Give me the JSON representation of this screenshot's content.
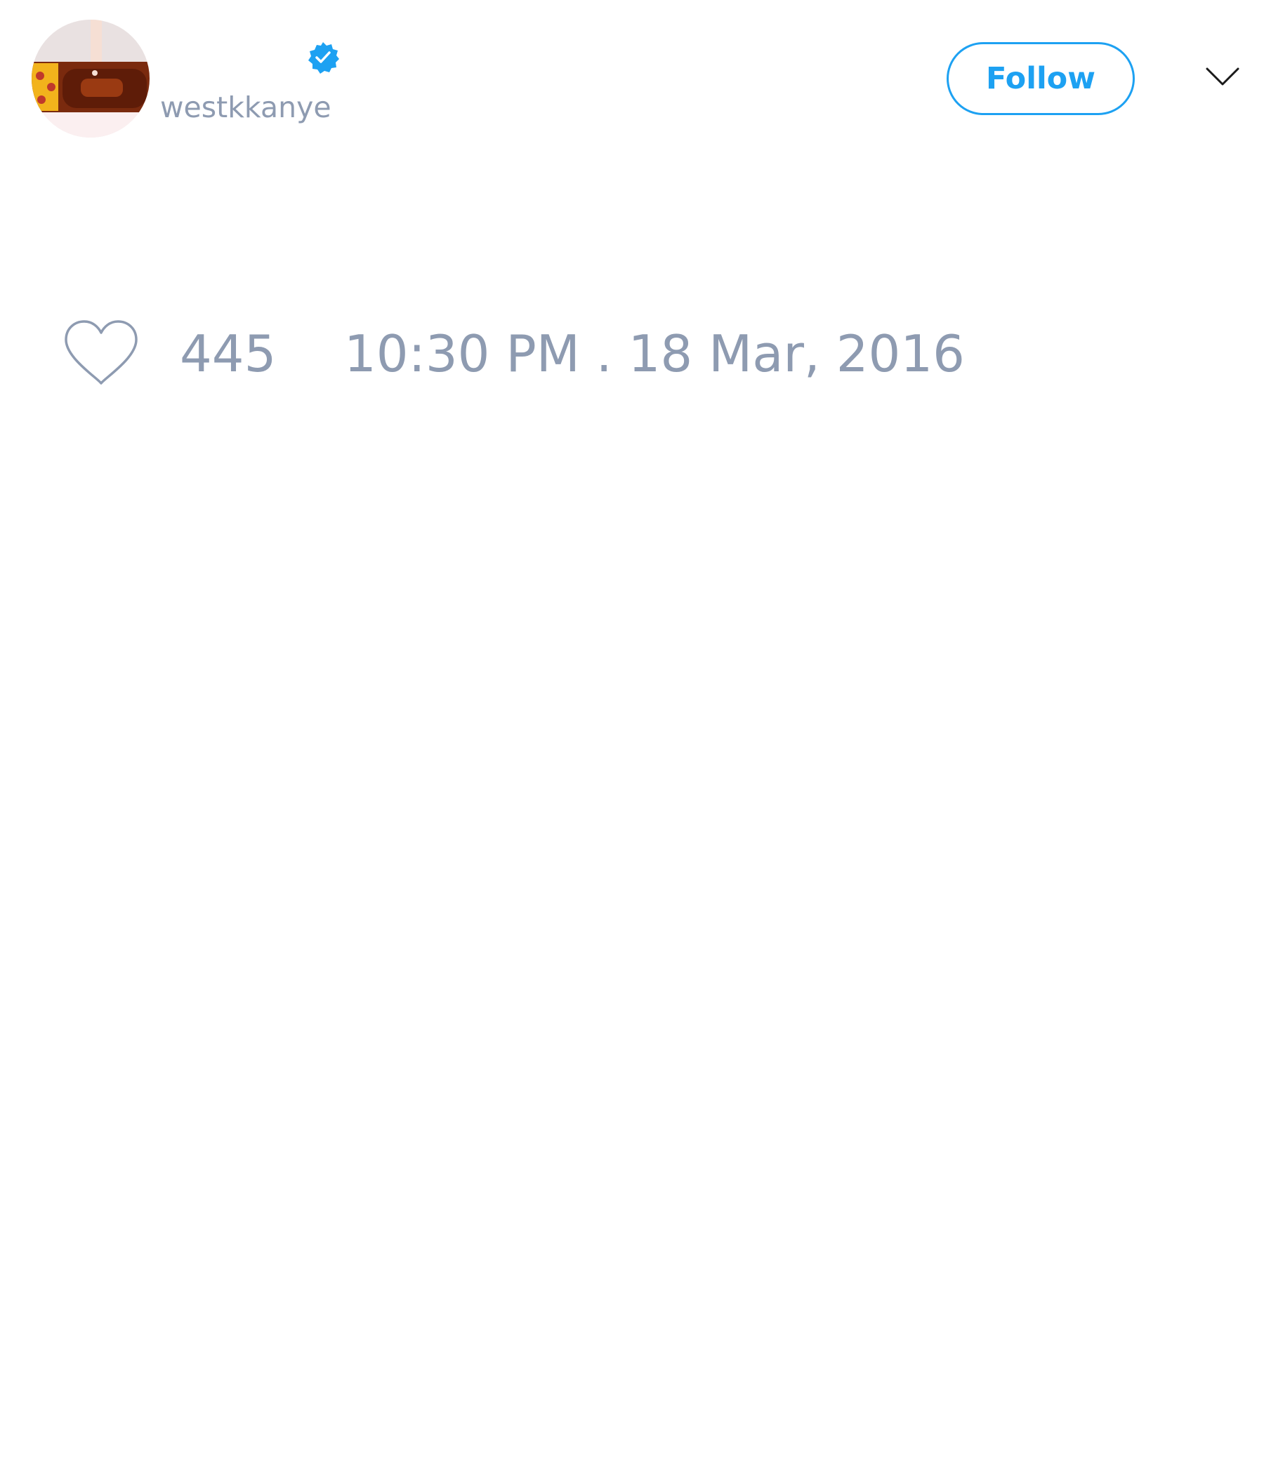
{
  "tweet": {
    "author": {
      "handle": "westkkanye",
      "verified": true,
      "avatar_icon": "profile-photo"
    },
    "follow_button": {
      "label": "Follow",
      "color": "#1da1f2"
    },
    "menu_icon": "chevron-down-icon",
    "likes": {
      "icon": "heart-icon",
      "count": "445"
    },
    "timestamp": "10:30 PM . 18 Mar, 2016"
  },
  "colors": {
    "accent": "#1da1f2",
    "muted_text": "#8e9bb1",
    "background": "#ffffff"
  }
}
